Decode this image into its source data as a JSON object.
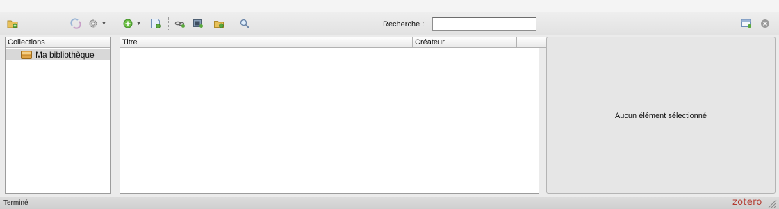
{
  "toolbar": {
    "icons": [
      "new-collection-icon",
      "sync-icon",
      "actions-gear-icon",
      "new-item-icon",
      "new-note-icon",
      "link-icon",
      "snapshot-icon",
      "import-icon",
      "advanced-search-icon",
      "toggle-pane-icon",
      "close-icon"
    ],
    "search_label": "Recherche :",
    "search_value": ""
  },
  "collections": {
    "header": "Collections",
    "items": [
      {
        "label": "Ma bibliothèque",
        "icon": "library-icon",
        "selected": true
      }
    ]
  },
  "items": {
    "columns": [
      {
        "label": "Titre"
      },
      {
        "label": "Créateur"
      }
    ],
    "add_column_label": "+"
  },
  "item_pane": {
    "message": "Aucun élément sélectionné"
  },
  "status": {
    "text": "Terminé",
    "brand": "zotero"
  },
  "colors": {
    "brand": "#b33a30",
    "selection": "#d8d8d8",
    "folder": "#e0a446"
  }
}
